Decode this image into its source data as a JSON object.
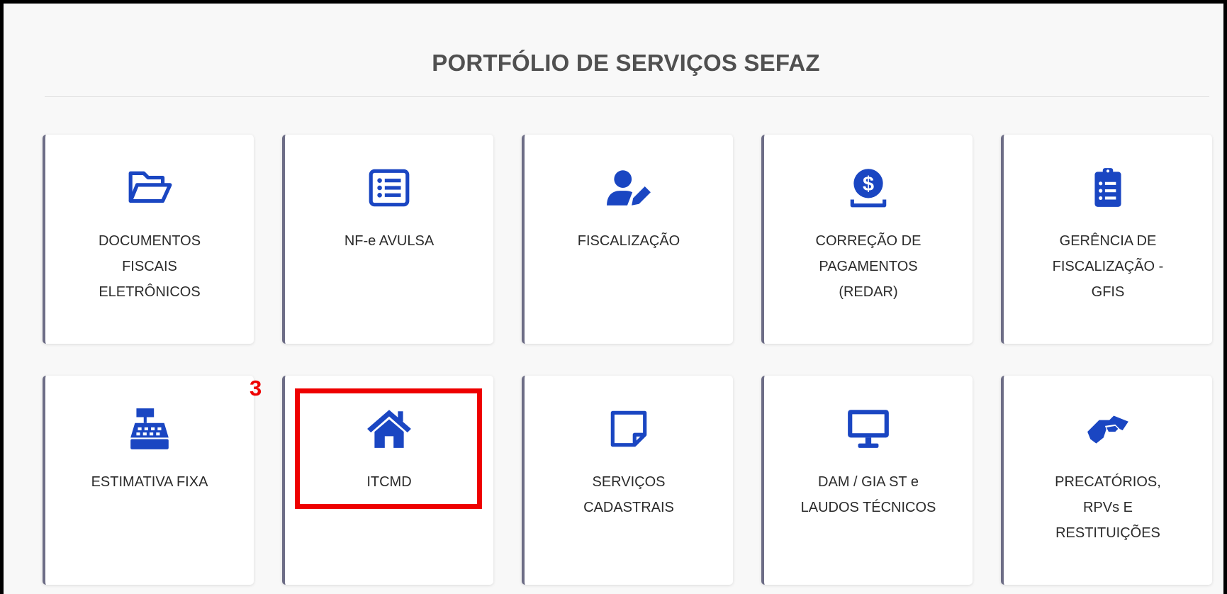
{
  "page": {
    "title": "PORTFÓLIO DE SERVIÇOS SEFAZ"
  },
  "cards": [
    {
      "label": "DOCUMENTOS FISCAIS ELETRÔNICOS",
      "icon": "folder-open-icon"
    },
    {
      "label": "NF-e AVULSA",
      "icon": "list-document-icon"
    },
    {
      "label": "FISCALIZAÇÃO",
      "icon": "user-edit-icon"
    },
    {
      "label": "CORREÇÃO DE PAGAMENTOS (REDAR)",
      "icon": "dollar-coin-icon"
    },
    {
      "label": "GERÊNCIA DE FISCALIZAÇÃO - GFIS",
      "icon": "clipboard-list-icon"
    },
    {
      "label": "ESTIMATIVA FIXA",
      "icon": "cash-register-icon"
    },
    {
      "label": "ITCMD",
      "icon": "home-icon"
    },
    {
      "label": "SERVIÇOS CADASTRAIS",
      "icon": "sticky-note-icon"
    },
    {
      "label": "DAM / GIA ST e LAUDOS TÉCNICOS",
      "icon": "desktop-icon"
    },
    {
      "label": "PRECATÓRIOS, RPVs E RESTITUIÇÕES",
      "icon": "handshake-icon"
    }
  ],
  "annotation": {
    "number": "3",
    "color": "#ee0000"
  },
  "colors": {
    "icon": "#1a46c2",
    "card_border": "#6d6d86",
    "title": "#505050"
  }
}
